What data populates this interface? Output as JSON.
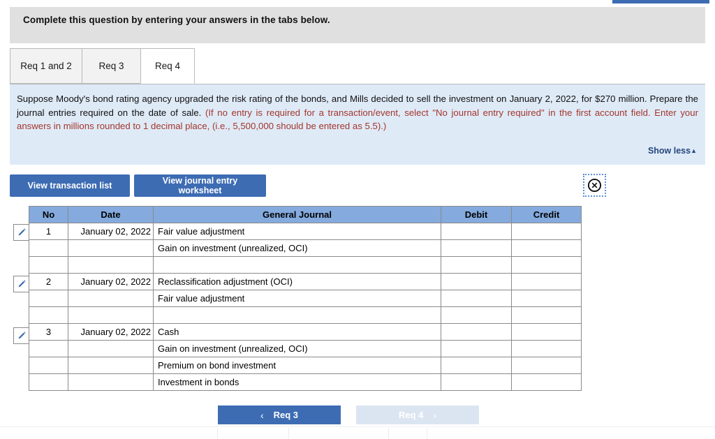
{
  "banner": {
    "text": "Complete this question by entering your answers in the tabs below."
  },
  "tabs": [
    {
      "label": "Req 1 and 2",
      "active": false
    },
    {
      "label": "Req 3",
      "active": false
    },
    {
      "label": "Req 4",
      "active": true
    }
  ],
  "question": {
    "body": "Suppose Moody's bond rating agency upgraded the risk rating of the bonds, and Mills decided to sell the investment on January 2, 2022, for $270 million. Prepare the journal entries required on the date of sale.",
    "hint": "(If no entry is required for a transaction/event, select \"No journal entry required\" in the first account field. Enter your answers in millions rounded to 1 decimal place, (i.e., 5,500,000 should be entered as 5.5).)",
    "show_less_label": "Show less",
    "show_less_caret": "▲"
  },
  "toolbar": {
    "transaction_list_label": "View transaction list",
    "worksheet_label": "View journal entry worksheet",
    "close_icon_name": "close-circle-icon"
  },
  "table": {
    "headers": [
      "No",
      "Date",
      "General Journal",
      "Debit",
      "Credit"
    ],
    "rows": [
      {
        "edit": true,
        "no": "1",
        "date": "January 02, 2022",
        "account": "Fair value adjustment",
        "debit": "",
        "credit": ""
      },
      {
        "edit": false,
        "no": "",
        "date": "",
        "account": "Gain on investment (unrealized, OCI)",
        "debit": "",
        "credit": ""
      },
      {
        "edit": false,
        "no": "",
        "date": "",
        "account": "",
        "debit": "",
        "credit": ""
      },
      {
        "edit": true,
        "no": "2",
        "date": "January 02, 2022",
        "account": "Reclassification adjustment (OCI)",
        "debit": "",
        "credit": ""
      },
      {
        "edit": false,
        "no": "",
        "date": "",
        "account": "Fair value adjustment",
        "debit": "",
        "credit": ""
      },
      {
        "edit": false,
        "no": "",
        "date": "",
        "account": "",
        "debit": "",
        "credit": ""
      },
      {
        "edit": true,
        "no": "3",
        "date": "January 02, 2022",
        "account": "Cash",
        "debit": "",
        "credit": ""
      },
      {
        "edit": false,
        "no": "",
        "date": "",
        "account": "Gain on investment (unrealized, OCI)",
        "debit": "",
        "credit": ""
      },
      {
        "edit": false,
        "no": "",
        "date": "",
        "account": "Premium on bond investment",
        "debit": "",
        "credit": ""
      },
      {
        "edit": false,
        "no": "",
        "date": "",
        "account": "Investment in bonds",
        "debit": "",
        "credit": ""
      }
    ]
  },
  "nav": {
    "prev_label": "Req 3",
    "prev_chevron": "‹",
    "next_label": "Req 4",
    "next_chevron": "›"
  },
  "colors": {
    "primary_blue": "#3d6cb3",
    "table_header_blue": "#84aade",
    "panel_blue": "#dfeaf7",
    "banner_gray": "#e0e0e0",
    "hint_red": "#a2362c",
    "link_navy": "#22477d",
    "next_disabled": "#dbe5f2"
  }
}
